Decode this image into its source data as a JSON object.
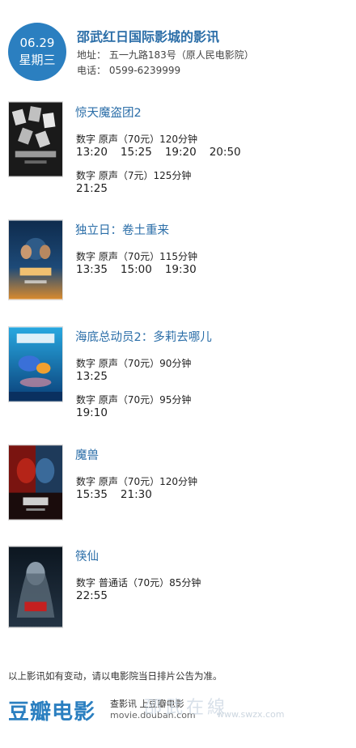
{
  "header": {
    "date": "06.29",
    "weekday": "星期三",
    "cinema_name": "邵武红日国际影城的影讯",
    "address": "地址：  五一九路183号（原人民电影院）",
    "phone": "电话：  0599-6239999"
  },
  "movies": [
    {
      "title": "惊天魔盗团2",
      "showings": [
        {
          "format": "数字  原声（70元）120分钟",
          "times": [
            "13:20",
            "15:25",
            "19:20",
            "20:50"
          ]
        },
        {
          "format": "数字  原声（7元）125分钟",
          "times": [
            "21:25"
          ]
        }
      ],
      "poster_colors": [
        "#1a1a1a",
        "#b0b0b0"
      ]
    },
    {
      "title": "独立日：卷土重来",
      "showings": [
        {
          "format": "数字  原声（70元）115分钟",
          "times": [
            "13:35",
            "15:00",
            "19:30"
          ]
        }
      ],
      "poster_colors": [
        "#0e2b4d",
        "#d88a2e"
      ]
    },
    {
      "title": "海底总动员2：多莉去哪儿",
      "showings": [
        {
          "format": "数字  原声（70元）90分钟",
          "times": [
            "13:25"
          ]
        },
        {
          "format": "数字  原声（70元）95分钟",
          "times": [
            "19:10"
          ]
        }
      ],
      "poster_colors": [
        "#0a5fa8",
        "#28a8e0"
      ]
    },
    {
      "title": "魔兽",
      "showings": [
        {
          "format": "数字  原声（70元）120分钟",
          "times": [
            "15:35",
            "21:30"
          ]
        }
      ],
      "poster_colors": [
        "#1a0c0c",
        "#b52418"
      ]
    },
    {
      "title": "筷仙",
      "showings": [
        {
          "format": "数字  普通话（70元）85分钟",
          "times": [
            "22:55"
          ]
        }
      ],
      "poster_colors": [
        "#0c1620",
        "#8a9aa8"
      ]
    }
  ],
  "footer": {
    "note": "以上影讯如有变动，请以电影院当日排片公告为准。",
    "logo": "豆瓣电影",
    "slogan1": "查影讯  上豆瓣电影",
    "slogan2": "movie.douban.com",
    "watermark": "邵武在線",
    "watermark_url": "www.swzx.com"
  },
  "colors": {
    "accent": "#2b7fc0",
    "title": "#2b6ea8"
  }
}
